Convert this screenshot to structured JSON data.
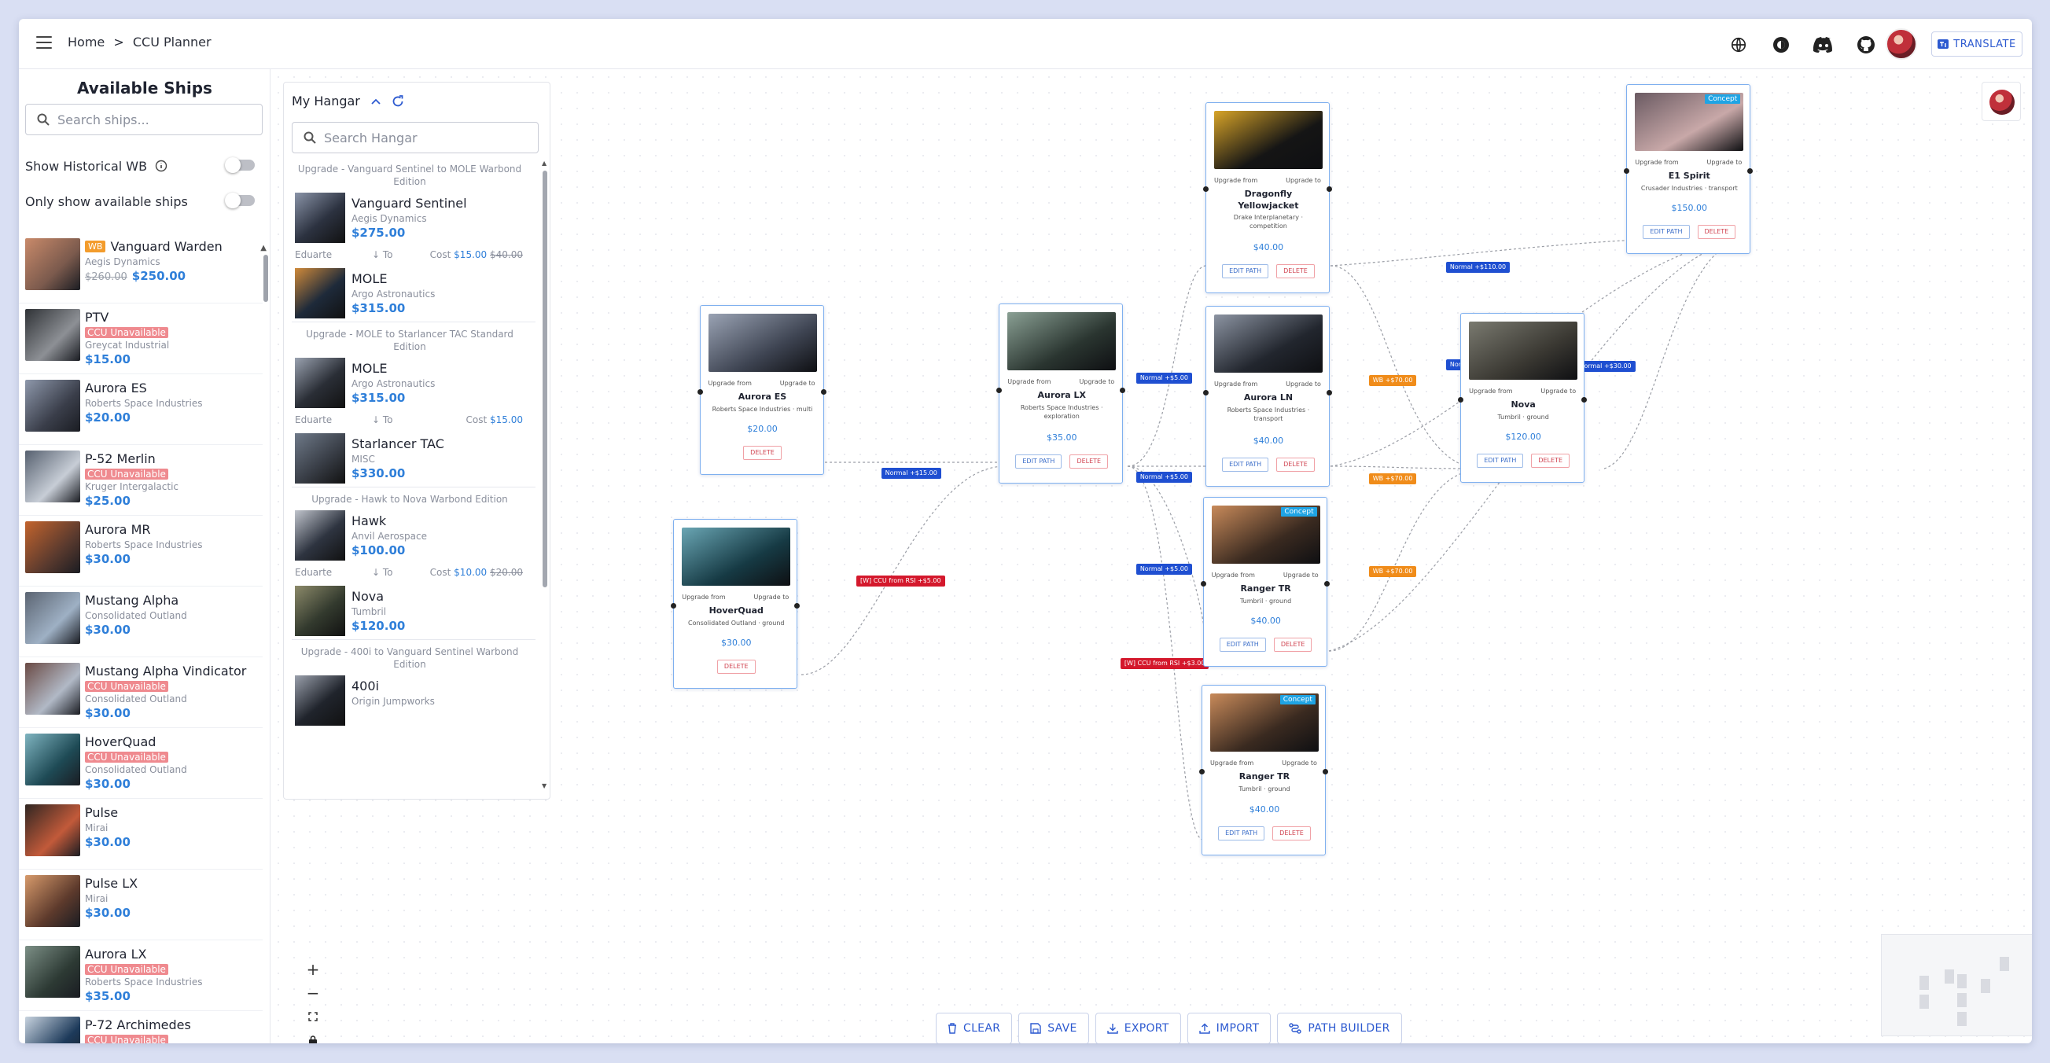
{
  "header": {
    "breadcrumb": [
      "Home",
      ">",
      "CCU Planner"
    ],
    "translate_label": "TRANSLATE",
    "icons": [
      "menu-icon",
      "globe-icon",
      "theme-toggle-icon",
      "discord-icon",
      "github-icon"
    ]
  },
  "sidebar": {
    "title": "Available Ships",
    "search_placeholder": "Search ships...",
    "toggle_historical": "Show Historical WB",
    "toggle_available": "Only show available ships",
    "ships": [
      {
        "name": "Vanguard Warden",
        "badge": "WB",
        "mfr": "Aegis Dynamics",
        "old_price": "$260.00",
        "price": "$250.00",
        "colors": [
          "#7b5a4d",
          "#c98a6a"
        ]
      },
      {
        "name": "PTV",
        "ccu": "CCU Unavailable",
        "mfr": "Greycat Industrial",
        "price": "$15.00",
        "colors": [
          "#8d9095",
          "#2f3236"
        ]
      },
      {
        "name": "Aurora ES",
        "mfr": "Roberts Space Industries",
        "price": "$20.00",
        "colors": [
          "#3a3e4a",
          "#8e98ab"
        ]
      },
      {
        "name": "P-52 Merlin",
        "ccu": "CCU Unavailable",
        "mfr": "Kruger Intergalactic",
        "price": "$25.00",
        "colors": [
          "#c7cdd6",
          "#56606f"
        ]
      },
      {
        "name": "Aurora MR",
        "mfr": "Roberts Space Industries",
        "price": "$30.00",
        "colors": [
          "#5a3a2e",
          "#c3642d"
        ]
      },
      {
        "name": "Mustang Alpha",
        "mfr": "Consolidated Outland",
        "price": "$30.00",
        "colors": [
          "#9eb0c4",
          "#5b6472"
        ]
      },
      {
        "name": "Mustang Alpha Vindicator",
        "ccu": "CCU Unavailable",
        "mfr": "Consolidated Outland",
        "price": "$30.00",
        "colors": [
          "#b1b9c6",
          "#6a4a44"
        ]
      },
      {
        "name": "HoverQuad",
        "ccu": "CCU Unavailable",
        "mfr": "Consolidated Outland",
        "price": "$30.00",
        "colors": [
          "#1e4a55",
          "#7fb4c0"
        ]
      },
      {
        "name": "Pulse",
        "mfr": "Mirai",
        "price": "$30.00",
        "colors": [
          "#c25a3a",
          "#302622"
        ]
      },
      {
        "name": "Pulse LX",
        "mfr": "Mirai",
        "price": "$30.00",
        "colors": [
          "#5d3a2c",
          "#d79a6b"
        ]
      },
      {
        "name": "Aurora LX",
        "ccu": "CCU Unavailable",
        "mfr": "Roberts Space Industries",
        "price": "$35.00",
        "colors": [
          "#2d3a34",
          "#7c8f86"
        ]
      },
      {
        "name": "P-72 Archimedes",
        "ccu": "CCU Unavailable",
        "mfr": "Kruger Intergalactic",
        "price": "$35.00",
        "colors": [
          "#1d3a5a",
          "#c8d3df"
        ]
      }
    ]
  },
  "hangar": {
    "title": "My Hangar",
    "search_placeholder": "Search Hangar",
    "groups": [
      {
        "title": "Upgrade - Vanguard Sentinel to MOLE Warbond Edition",
        "from": {
          "name": "Vanguard Sentinel",
          "mfr": "Aegis Dynamics",
          "price": "$275.00"
        },
        "meta": {
          "owner": "Eduarte",
          "to": "To",
          "cost_label": "Cost",
          "cost": "$15.00",
          "old_cost": "$40.00"
        },
        "to": {
          "name": "MOLE",
          "mfr": "Argo Astronautics",
          "price": "$315.00"
        }
      },
      {
        "title": "Upgrade - MOLE to Starlancer TAC Standard Edition",
        "from": {
          "name": "MOLE",
          "mfr": "Argo Astronautics",
          "price": "$315.00"
        },
        "meta": {
          "owner": "Eduarte",
          "to": "To",
          "cost_label": "Cost",
          "cost": "$15.00",
          "old_cost": ""
        },
        "to": {
          "name": "Starlancer TAC",
          "mfr": "MISC",
          "price": "$330.00"
        }
      },
      {
        "title": "Upgrade - Hawk to Nova Warbond Edition",
        "from": {
          "name": "Hawk",
          "mfr": "Anvil Aerospace",
          "price": "$100.00"
        },
        "meta": {
          "owner": "Eduarte",
          "to": "To",
          "cost_label": "Cost",
          "cost": "$10.00",
          "old_cost": "$20.00"
        },
        "to": {
          "name": "Nova",
          "mfr": "Tumbril",
          "price": "$120.00"
        }
      },
      {
        "title": "Upgrade - 400i to Vanguard Sentinel Warbond Edition",
        "from": {
          "name": "400i",
          "mfr": "Origin Jumpworks",
          "price": ""
        }
      }
    ]
  },
  "canvas": {
    "node_labels": {
      "upgrade_from": "Upgrade from",
      "upgrade_to": "Upgrade to",
      "edit": "EDIT PATH",
      "delete": "DELETE",
      "concept": "Concept"
    },
    "nodes": [
      {
        "id": "aurora-es",
        "name": "Aurora ES",
        "sub": "Roberts Space Industries · multi",
        "price": "$20.00",
        "edit": false
      },
      {
        "id": "hoverquad",
        "name": "HoverQuad",
        "sub": "Consolidated Outland · ground",
        "price": "$30.00",
        "edit": false
      },
      {
        "id": "aurora-lx",
        "name": "Aurora LX",
        "sub": "Roberts Space Industries · exploration",
        "price": "$35.00",
        "edit": true
      },
      {
        "id": "dragonfly",
        "name": "Dragonfly Yellowjacket",
        "sub": "Drake Interplanetary · competition",
        "price": "$40.00",
        "edit": true
      },
      {
        "id": "aurora-ln",
        "name": "Aurora LN",
        "sub": "Roberts Space Industries · transport",
        "price": "$40.00",
        "edit": true
      },
      {
        "id": "ranger-tr-1",
        "name": "Ranger TR",
        "sub": "Tumbril · ground",
        "price": "$40.00",
        "edit": true,
        "concept": true
      },
      {
        "id": "ranger-tr-2",
        "name": "Ranger TR",
        "sub": "Tumbril · ground",
        "price": "$40.00",
        "edit": true,
        "concept": true
      },
      {
        "id": "nova",
        "name": "Nova",
        "sub": "Tumbril · ground",
        "price": "$120.00",
        "edit": true
      },
      {
        "id": "e1-spirit",
        "name": "E1 Spirit",
        "sub": "Crusader Industries · transport",
        "price": "$150.00",
        "edit": true,
        "concept": true
      }
    ],
    "edge_labels": [
      {
        "text": "Normal +$15.00",
        "color": "blue"
      },
      {
        "text": "[W] CCU from RSI +$5.00",
        "color": "red"
      },
      {
        "text": "Normal +$5.00",
        "color": "blue"
      },
      {
        "text": "Normal +$5.00",
        "color": "blue"
      },
      {
        "text": "Normal +$5.00",
        "color": "blue"
      },
      {
        "text": "[W] CCU from RSI +$3.00",
        "color": "red"
      },
      {
        "text": "WB +$70.00",
        "color": "orange"
      },
      {
        "text": "WB +$70.00",
        "color": "orange"
      },
      {
        "text": "WB +$70.00",
        "color": "orange"
      },
      {
        "text": "Normal +$110.00",
        "color": "blue"
      },
      {
        "text": "Normal +$110.00",
        "color": "blue"
      },
      {
        "text": "Normal +$30.00",
        "color": "blue"
      }
    ]
  },
  "toolbar": {
    "clear": "CLEAR",
    "save": "SAVE",
    "export": "EXPORT",
    "import": "IMPORT",
    "path_builder": "PATH BUILDER"
  },
  "zoom": {
    "in": "+",
    "out": "−"
  }
}
